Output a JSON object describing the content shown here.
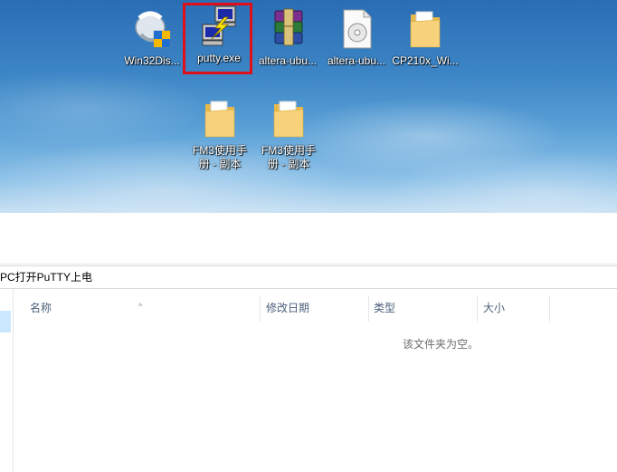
{
  "desktop": {
    "icons": [
      {
        "label": "Win32Dis...",
        "icon": "win32-disk-imager-icon"
      },
      {
        "label": "putty.exe",
        "icon": "putty-icon"
      },
      {
        "label": "altera-ubu...",
        "icon": "winrar-archive-icon"
      },
      {
        "label": "altera-ubu...",
        "icon": "disc-image-file-icon"
      },
      {
        "label": "CP210x_Wi...",
        "icon": "folder-icon"
      },
      {
        "label_line1": "FM3使用手",
        "label_line2": "册 - 副本",
        "icon": "folder-icon"
      },
      {
        "label_line1": "FM3使用手",
        "label_line2": "册 - 副本",
        "icon": "folder-icon"
      }
    ],
    "highlight_color": "#e0101a"
  },
  "explorer": {
    "address_text": "PC打开PuTTY上电",
    "columns": {
      "name": "名称",
      "date_modified": "修改日期",
      "type": "类型",
      "size": "大小"
    },
    "empty_message": "该文件夹为空。"
  }
}
